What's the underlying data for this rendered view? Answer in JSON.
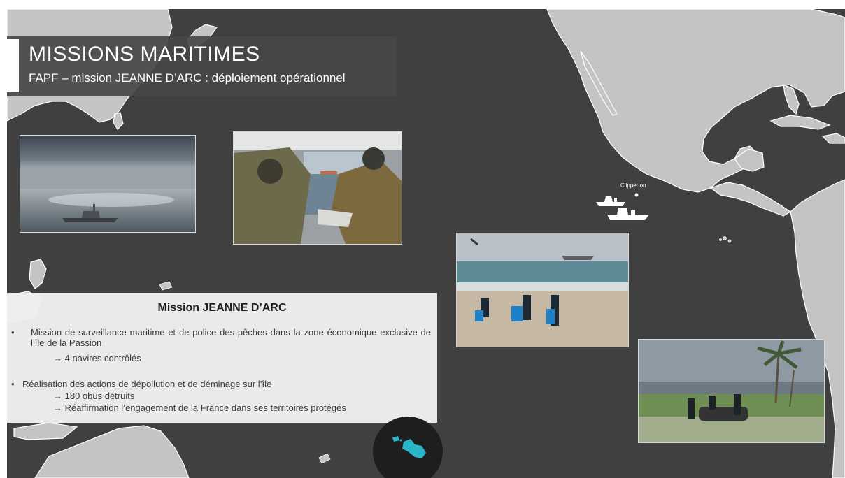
{
  "header": {
    "title": "MISSIONS MARITIMES",
    "subtitle": "FAPF – mission JEANNE D’ARC : déploiement opérationnel"
  },
  "map": {
    "label_clipperton": "Clipperton",
    "background_color": "#404040",
    "land_color": "#c4c4c4",
    "inset_color": "#29b6c9"
  },
  "info": {
    "title": "Mission JEANNE D’ARC",
    "bullet_symbol": "•",
    "bullet1": "Mission de surveillance maritime et de police des pêches dans la zone économique exclusive de l’île de la Passion",
    "bullet1_sub": "→ 4 navires contrôlés",
    "bullet2": "Réalisation des actions de dépollution et de déminage sur l’île",
    "bullet2_sub1": "→ 180 obus détruits",
    "bullet2_sub2": "→ Réaffirmation l’engagement de la France dans ses territoires protégés"
  }
}
